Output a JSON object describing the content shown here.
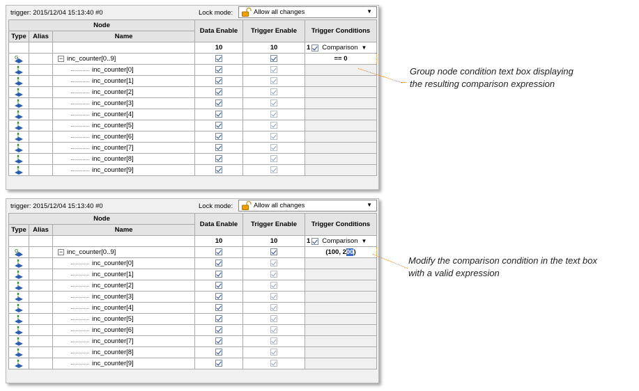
{
  "panels": [
    {
      "title": "trigger: 2015/12/04 15:13:40  #0",
      "lock_label": "Lock mode:",
      "lock_value": "Allow all changes",
      "headers": {
        "node": "Node",
        "type": "Type",
        "alias": "Alias",
        "name": "Name",
        "data_enable": "Data Enable",
        "trigger_enable": "Trigger Enable",
        "trigger_conditions": "Trigger Conditions"
      },
      "counts": {
        "data_enable": "10",
        "trigger_enable": "10",
        "trigger_conditions_prefix": "1",
        "comparison": "Comparison"
      },
      "group": {
        "name": "inc_counter[0..9]",
        "condition": "== 0"
      },
      "leaves": [
        "inc_counter[0]",
        "inc_counter[1]",
        "inc_counter[2]",
        "inc_counter[3]",
        "inc_counter[4]",
        "inc_counter[5]",
        "inc_counter[6]",
        "inc_counter[7]",
        "inc_counter[8]",
        "inc_counter[9]"
      ]
    },
    {
      "title": "trigger: 2015/12/04 15:13:40  #0",
      "lock_label": "Lock mode:",
      "lock_value": "Allow all changes",
      "headers": {
        "node": "Node",
        "type": "Type",
        "alias": "Alias",
        "name": "Name",
        "data_enable": "Data Enable",
        "trigger_enable": "Trigger Enable",
        "trigger_conditions": "Trigger Conditions"
      },
      "counts": {
        "data_enable": "10",
        "trigger_enable": "10",
        "trigger_conditions_prefix": "1",
        "comparison": "Comparison"
      },
      "group": {
        "name": "inc_counter[0..9]",
        "condition_before": "(100, 2",
        "condition_selected": "00",
        "condition_after": ")"
      },
      "leaves": [
        "inc_counter[0]",
        "inc_counter[1]",
        "inc_counter[2]",
        "inc_counter[3]",
        "inc_counter[4]",
        "inc_counter[5]",
        "inc_counter[6]",
        "inc_counter[7]",
        "inc_counter[8]",
        "inc_counter[9]"
      ]
    }
  ],
  "annotations": {
    "top": [
      "Group node condition text box displaying",
      "the resulting comparison expression"
    ],
    "bottom": [
      "Modify the comparison condition in the text box",
      "with a valid expression"
    ]
  },
  "colors": {
    "leader": "#e07a00",
    "selection": "#3a67c9",
    "lock": "#f0a000"
  },
  "icons": {
    "lock": "padlock-icon",
    "group_node": "group-node-icon",
    "leaf_node": "signal-node-icon"
  }
}
